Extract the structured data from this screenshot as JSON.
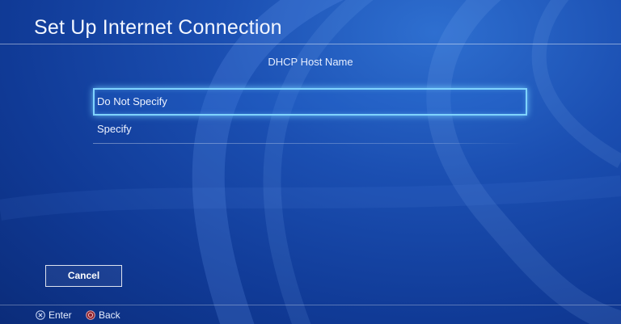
{
  "header": {
    "title": "Set Up Internet Connection"
  },
  "main": {
    "section_title": "DHCP Host Name",
    "options": [
      {
        "label": "Do Not Specify",
        "selected": true
      },
      {
        "label": "Specify",
        "selected": false
      }
    ],
    "cancel_label": "Cancel"
  },
  "footer": {
    "hints": [
      {
        "icon": "cross-button-icon",
        "label": "Enter"
      },
      {
        "icon": "circle-button-icon",
        "label": "Back"
      }
    ]
  },
  "colors": {
    "background": "#1b4fb2",
    "selection_border": "#7fd3ff",
    "text": "#ffffff"
  }
}
